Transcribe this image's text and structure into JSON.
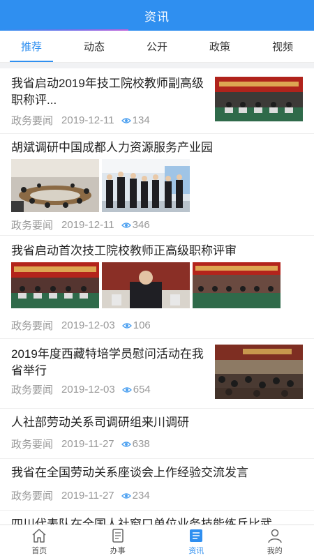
{
  "header": {
    "title": "资讯"
  },
  "tabs": [
    {
      "label": "推荐",
      "active": true
    },
    {
      "label": "动态",
      "active": false
    },
    {
      "label": "公开",
      "active": false
    },
    {
      "label": "政策",
      "active": false
    },
    {
      "label": "视频",
      "active": false
    }
  ],
  "articles": [
    {
      "title": "我省启动2019年技工院校教师副高级职称评...",
      "source": "政务要闻",
      "date": "2019-12-11",
      "views": "134"
    },
    {
      "title": "胡斌调研中国成都人力资源服务产业园",
      "source": "政务要闻",
      "date": "2019-12-11",
      "views": "346"
    },
    {
      "title": "我省启动首次技工院校教师正高级职称评审",
      "source": "政务要闻",
      "date": "2019-12-03",
      "views": "106"
    },
    {
      "title": "2019年度西藏特培学员慰问活动在我省举行",
      "source": "政务要闻",
      "date": "2019-12-03",
      "views": "654"
    },
    {
      "title": "人社部劳动关系司调研组来川调研",
      "source": "政务要闻",
      "date": "2019-11-27",
      "views": "638"
    },
    {
      "title": "我省在全国劳动关系座谈会上作经验交流发言",
      "source": "政务要闻",
      "date": "2019-11-27",
      "views": "234"
    },
    {
      "title": "四川代表队在全国人社窗口单位业务技能练兵比武",
      "source": "",
      "date": "",
      "views": ""
    }
  ],
  "tabbar": [
    {
      "label": "首页",
      "icon": "home-icon",
      "active": false
    },
    {
      "label": "办事",
      "icon": "document-icon",
      "active": false
    },
    {
      "label": "资讯",
      "icon": "news-icon",
      "active": true
    },
    {
      "label": "我的",
      "icon": "user-icon",
      "active": false
    }
  ],
  "colors": {
    "primary": "#2f8ff0",
    "text": "#222222",
    "meta": "#999999"
  }
}
